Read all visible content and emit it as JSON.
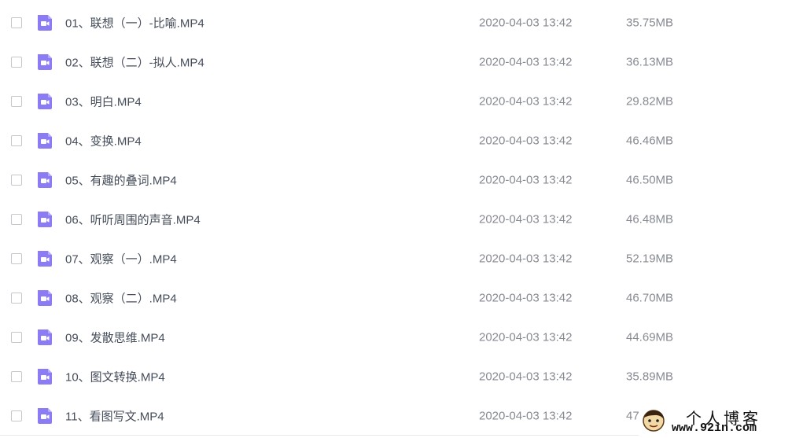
{
  "icon": {
    "name": "video-file-icon",
    "color": "#8b7cf6"
  },
  "files": [
    {
      "name": "01、联想（一）-比喻.MP4",
      "date": "2020-04-03 13:42",
      "size": "35.75MB"
    },
    {
      "name": "02、联想（二）-拟人.MP4",
      "date": "2020-04-03 13:42",
      "size": "36.13MB"
    },
    {
      "name": "03、明白.MP4",
      "date": "2020-04-03 13:42",
      "size": "29.82MB"
    },
    {
      "name": "04、变换.MP4",
      "date": "2020-04-03 13:42",
      "size": "46.46MB"
    },
    {
      "name": "05、有趣的叠词.MP4",
      "date": "2020-04-03 13:42",
      "size": "46.50MB"
    },
    {
      "name": "06、听听周围的声音.MP4",
      "date": "2020-04-03 13:42",
      "size": "46.48MB"
    },
    {
      "name": "07、观察（一）.MP4",
      "date": "2020-04-03 13:42",
      "size": "52.19MB"
    },
    {
      "name": "08、观察（二）.MP4",
      "date": "2020-04-03 13:42",
      "size": "46.70MB"
    },
    {
      "name": "09、发散思维.MP4",
      "date": "2020-04-03 13:42",
      "size": "44.69MB"
    },
    {
      "name": "10、图文转换.MP4",
      "date": "2020-04-03 13:42",
      "size": "35.89MB"
    },
    {
      "name": "11、看图写文.MP4",
      "date": "2020-04-03 13:42",
      "size": "47"
    }
  ],
  "watermark": {
    "title": "个人博客",
    "url": "www.92in.com"
  }
}
